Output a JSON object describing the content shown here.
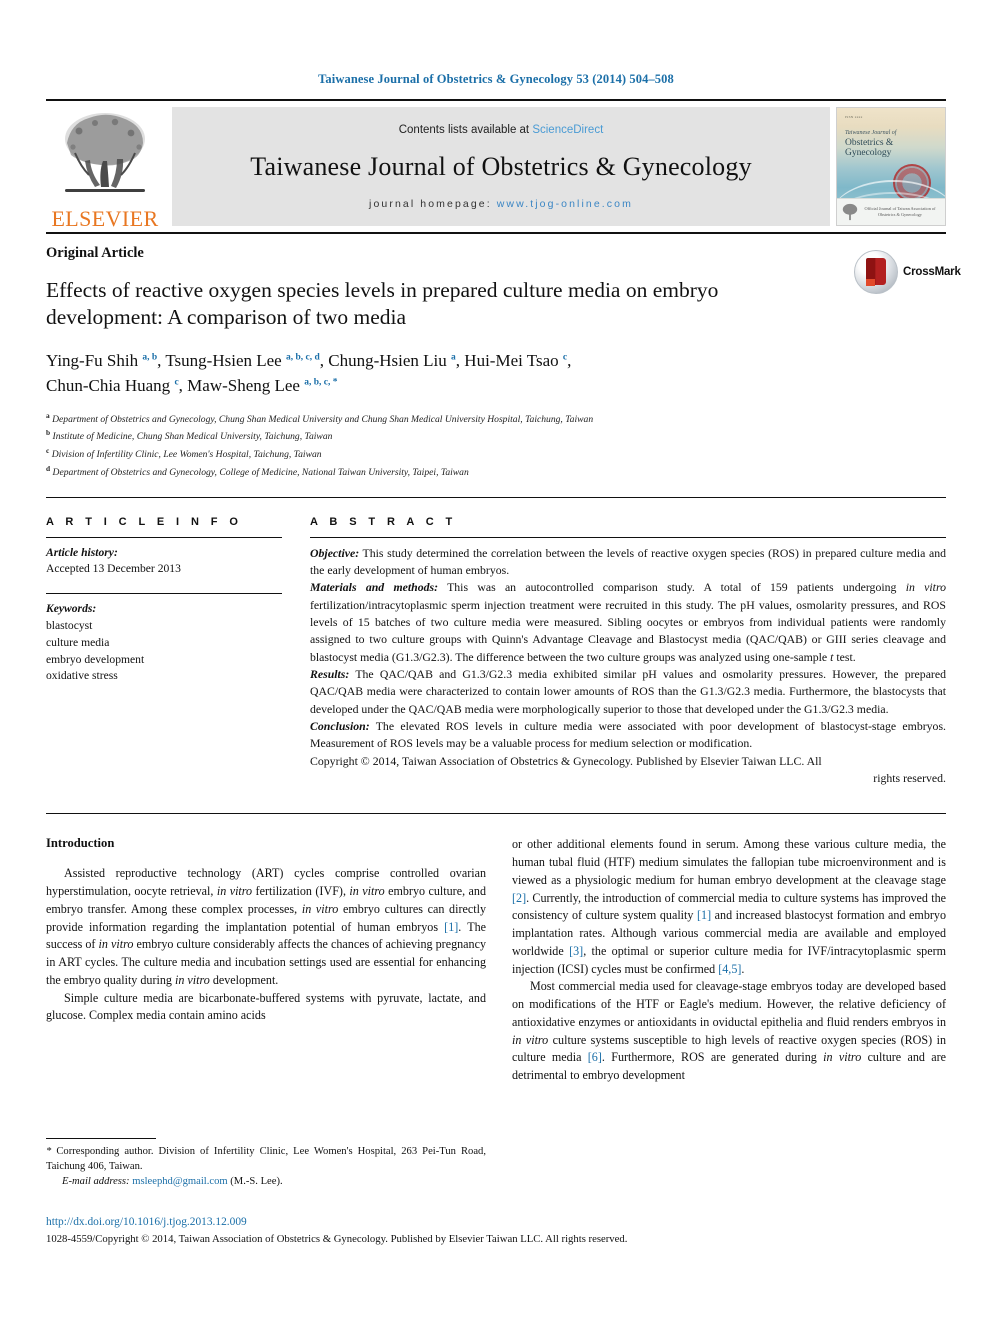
{
  "running_head": "Taiwanese Journal of Obstetrics & Gynecology 53 (2014) 504–508",
  "masthead": {
    "publisher_name": "ELSEVIER",
    "contents_prefix": "Contents lists available at ",
    "contents_link": "ScienceDirect",
    "journal_title": "Taiwanese Journal of Obstetrics & Gynecology",
    "homepage_prefix": "journal homepage: ",
    "homepage_url": "www.tjog-online.com",
    "cover": {
      "top_label": "ISSN xxxx",
      "line1": "Taiwanese Journal of",
      "line2": "Obstetrics & Gynecology",
      "footer_text": "Official Journal of Taiwan Association of Obstetrics & Gynecology"
    }
  },
  "article": {
    "kicker": "Original Article",
    "title": "Effects of reactive oxygen species levels in prepared culture media on embryo development: A comparison of two media",
    "crossmark_label": "CrossMark",
    "authors_line1": "Ying-Fu Shih <sup>a, b</sup>, Tsung-Hsien Lee <sup>a, b, c, d</sup>, Chung-Hsien Liu <sup>a</sup>, Hui-Mei Tsao <sup>c</sup>,",
    "authors_line2": "Chun-Chia Huang <sup>c</sup>, Maw-Sheng Lee <sup>a, b, c, *</sup>",
    "affiliations": [
      {
        "mark": "a",
        "text": "Department of Obstetrics and Gynecology, Chung Shan Medical University and Chung Shan Medical University Hospital, Taichung, Taiwan"
      },
      {
        "mark": "b",
        "text": "Institute of Medicine, Chung Shan Medical University, Taichung, Taiwan"
      },
      {
        "mark": "c",
        "text": "Division of Infertility Clinic, Lee Women's Hospital, Taichung, Taiwan"
      },
      {
        "mark": "d",
        "text": "Department of Obstetrics and Gynecology, College of Medicine, National Taiwan University, Taipei, Taiwan"
      }
    ]
  },
  "article_info": {
    "heading": "A R T I C L E  I N F O",
    "history_label": "Article history:",
    "history_value": "Accepted 13 December 2013",
    "keywords_label": "Keywords:",
    "keywords": [
      "blastocyst",
      "culture media",
      "embryo development",
      "oxidative stress"
    ]
  },
  "abstract": {
    "heading": "A B S T R A C T",
    "objective_label": "Objective:",
    "objective_text": " This study determined the correlation between the levels of reactive oxygen species (ROS) in prepared culture media and the early development of human embryos.",
    "methods_label": "Materials and methods:",
    "methods_text": " This was an autocontrolled comparison study. A total of 159 patients undergoing <em>in vitro</em> fertilization/intracytoplasmic sperm injection treatment were recruited in this study. The pH values, osmolarity pressures, and ROS levels of 15 batches of two culture media were measured. Sibling oocytes or embryos from individual patients were randomly assigned to two culture groups with Quinn's Advantage Cleavage and Blastocyst media (QAC/QAB) or GIII series cleavage and blastocyst media (G1.3/G2.3). The difference between the two culture groups was analyzed using one-sample <em>t</em> test.",
    "results_label": "Results:",
    "results_text": " The QAC/QAB and G1.3/G2.3 media exhibited similar pH values and osmolarity pressures. However, the prepared QAC/QAB media were characterized to contain lower amounts of ROS than the G1.3/G2.3 media. Furthermore, the blastocysts that developed under the QAC/QAB media were morphologically superior to those that developed under the G1.3/G2.3 media.",
    "conclusion_label": "Conclusion:",
    "conclusion_text": " The elevated ROS levels in culture media were associated with poor development of blastocyst-stage embryos. Measurement of ROS levels may be a valuable process for medium selection or modification.",
    "copyright": "Copyright © 2014, Taiwan Association of Obstetrics & Gynecology. Published by Elsevier Taiwan LLC. All",
    "copyright_last": "rights reserved."
  },
  "body": {
    "intro_heading": "Introduction",
    "left_p1": "Assisted reproductive technology (ART) cycles comprise controlled ovarian hyperstimulation, oocyte retrieval, <em>in vitro</em> fertilization (IVF), <em>in vitro</em> embryo culture, and embryo transfer. Among these complex processes, <em>in vitro</em> embryo cultures can directly provide information regarding the implantation potential of human embryos <span class=\"ref\">[1]</span>. The success of <em>in vitro</em> embryo culture considerably affects the chances of achieving pregnancy in ART cycles. The culture media and incubation settings used are essential for enhancing the embryo quality during <em>in vitro</em> development.",
    "left_p2": "Simple culture media are bicarbonate-buffered systems with pyruvate, lactate, and glucose. Complex media contain amino acids",
    "right_p1": "or other additional elements found in serum. Among these various culture media, the human tubal fluid (HTF) medium simulates the fallopian tube microenvironment and is viewed as a physiologic medium for human embryo development at the cleavage stage <span class=\"ref\">[2]</span>. Currently, the introduction of commercial media to culture systems has improved the consistency of culture system quality <span class=\"ref\">[1]</span> and increased blastocyst formation and embryo implantation rates. Although various commercial media are available and employed worldwide <span class=\"ref\">[3]</span>, the optimal or superior culture media for IVF/intracytoplasmic sperm injection (ICSI) cycles must be confirmed <span class=\"ref\">[4,5]</span>.",
    "right_p2": "Most commercial media used for cleavage-stage embryos today are developed based on modifications of the HTF or Eagle's medium. However, the relative deficiency of antioxidative enzymes or antioxidants in oviductal epithelia and fluid renders embryos in <em>in vitro</em> culture systems susceptible to high levels of reactive oxygen species (ROS) in culture media <span class=\"ref\">[6]</span>. Furthermore, ROS are generated during <em>in vitro</em> culture and are detrimental to embryo development"
  },
  "footnotes": {
    "corresponding": "<span class=\"em\">*</span> Corresponding author. Division of Infertility Clinic, Lee Women's Hospital, 263 Pei-Tun Road, Taichung 406, Taiwan.",
    "email_label": "E-mail address:",
    "email_value": "msleephd@gmail.com",
    "email_suffix": " (M.-S. Lee)."
  },
  "footer": {
    "doi": "http://dx.doi.org/10.1016/j.tjog.2013.12.009",
    "issn_line": "1028-4559/Copyright © 2014, Taiwan Association of Obstetrics & Gynecology. Published by Elsevier Taiwan LLC. All rights reserved."
  },
  "colors": {
    "link_blue": "#1b6fa8",
    "sciencedirect_blue": "#4a9bd4",
    "elsevier_orange": "#E87722",
    "masthead_grey": "#e3e3e3"
  }
}
